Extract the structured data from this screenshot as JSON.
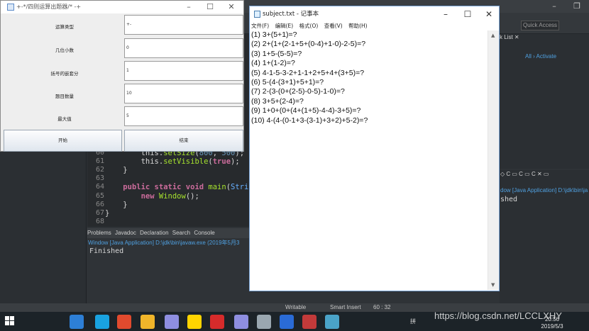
{
  "eclipse": {
    "quick_access": "Quick Access",
    "window_controls": [
      "–",
      "❐",
      "✕"
    ],
    "editor_lines": [
      {
        "num": "60",
        "parts": [
          {
            "t": "        this.",
            "c": ""
          },
          {
            "t": "setSize",
            "c": "fn"
          },
          {
            "t": "(",
            "c": ""
          },
          {
            "t": "800",
            "c": "num"
          },
          {
            "t": ", ",
            "c": ""
          },
          {
            "t": "500",
            "c": "num"
          },
          {
            "t": ");",
            "c": ""
          }
        ]
      },
      {
        "num": "61",
        "parts": [
          {
            "t": "        this.",
            "c": ""
          },
          {
            "t": "setVisible",
            "c": "fn"
          },
          {
            "t": "(",
            "c": ""
          },
          {
            "t": "true",
            "c": "bool"
          },
          {
            "t": ");",
            "c": ""
          }
        ]
      },
      {
        "num": "62",
        "parts": [
          {
            "t": "    }",
            "c": ""
          }
        ]
      },
      {
        "num": "63",
        "parts": [
          {
            "t": "",
            "c": ""
          }
        ]
      },
      {
        "num": "64",
        "parts": [
          {
            "t": "    ",
            "c": ""
          },
          {
            "t": "public static void ",
            "c": "kw"
          },
          {
            "t": "main",
            "c": "fn"
          },
          {
            "t": "(",
            "c": ""
          },
          {
            "t": "String",
            "c": "ty"
          },
          {
            "t": "[]",
            "c": ""
          }
        ]
      },
      {
        "num": "65",
        "parts": [
          {
            "t": "        ",
            "c": ""
          },
          {
            "t": "new ",
            "c": "kw"
          },
          {
            "t": "Window",
            "c": "fn"
          },
          {
            "t": "();",
            "c": ""
          }
        ]
      },
      {
        "num": "66",
        "parts": [
          {
            "t": "    }",
            "c": ""
          }
        ]
      },
      {
        "num": "67",
        "parts": [
          {
            "t": "}",
            "c": ""
          }
        ]
      },
      {
        "num": "68",
        "parts": [
          {
            "t": "",
            "c": ""
          }
        ]
      }
    ],
    "console_tabs": [
      "Problems",
      "Javadoc",
      "Declaration",
      "Search",
      "Console"
    ],
    "console_path": "Window [Java Application] D:\\jdk\\bin\\javaw.exe (2019年5月3",
    "console_output": "Finished",
    "right_tab": "k List ✕",
    "right_links": "All  ›  Activate",
    "right_bottom_tabs": "◇ C  ▭ C  ▭ C ✕  ▭",
    "right_path": "dow [Java Application] D:\\jdk\\bin\\ja",
    "right_output": "shed",
    "status": {
      "writable": "Writable",
      "insert": "Smart Insert",
      "position": "60 : 32"
    }
  },
  "dialog": {
    "title": "+-*/四则运算出题器/* -+",
    "window_controls": [
      "–",
      "☐",
      "✕"
    ],
    "fields": [
      {
        "label": "运算类型",
        "value": "+-"
      },
      {
        "label": "几位小数",
        "value": "0"
      },
      {
        "label": "括号的嵌套分",
        "value": "1"
      },
      {
        "label": "题目数量",
        "value": "10"
      },
      {
        "label": "最大值",
        "value": "5"
      }
    ],
    "start_label": "开始",
    "end_label": "结束"
  },
  "notepad": {
    "title": "subject.txt - 记事本",
    "window_controls": [
      "–",
      "☐",
      "✕"
    ],
    "menu": [
      "文件(F)",
      "编辑(E)",
      "格式(O)",
      "查看(V)",
      "帮助(H)"
    ],
    "lines": [
      "(1) 3+(5+1)=?",
      "(2) 2+(1+(2-1+5+(0-4)+1-0)-2-5)=?",
      "(3) 1+5-(5-5)=?",
      "(4) 1+(1-2)=?",
      "(5) 4-1-5-3-2+1-1+2+5+4+(3+5)=?",
      "(6) 5-(4-(3+1)+5+1)=?",
      "(7) 2-(3-(0+(2-5)-0-5)-1-0)=?",
      "(8) 3+5+(2-4)=?",
      "(9) 1+0+(0+(4+(1+5)-4-4)-3+5)=?",
      "(10) 4-(4-(0-1+3-(3-1)+3+2)+5-2)=?"
    ]
  },
  "taskbar": {
    "clock_time": "20:56",
    "clock_date": "2019/5/3",
    "ime": "拼",
    "watermark": "https://blog.csdn.net/LCCLXHY",
    "app_colors": [
      "#2d7fd6",
      "#19a2e0",
      "#e14a2e",
      "#f0b52a",
      "#8e8ee0",
      "#ffd400",
      "#d62b2b",
      "#8e8ee0",
      "#9aa7b0",
      "#2a6bd6",
      "#c23a3a",
      "#4aa3c8"
    ]
  }
}
